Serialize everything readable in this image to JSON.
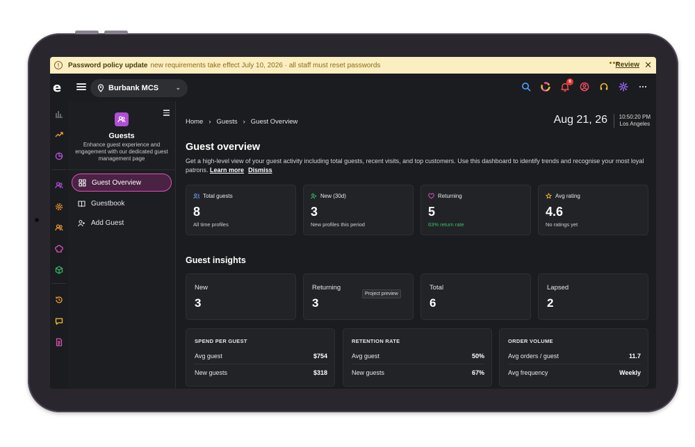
{
  "colors": {
    "accent": "#e052b8",
    "banner_bg": "#fbeec1",
    "positive": "#34c26b",
    "screen_bg": "#1b1c1f"
  },
  "banner": {
    "icon": "warning-icon",
    "title": "Password policy update",
    "message": "new requirements take effect July 10, 2026 · all staff must reset passwords",
    "review_label": "Review",
    "close_label": "✕"
  },
  "topbar": {
    "logo": "e",
    "location": "Burbank MCS",
    "notification_count": "6",
    "icons": [
      "search-icon",
      "app-switcher-icon",
      "bell-icon",
      "user-circle-icon",
      "headset-icon",
      "settings-icon",
      "more-icon"
    ]
  },
  "rail": {
    "icons": [
      "bar-chart-icon",
      "trend-icon",
      "pie-chart-icon",
      "guests-icon",
      "gear-icon",
      "staff-icon",
      "chef-hat-icon",
      "cube-icon",
      "history-icon",
      "chat-icon",
      "document-icon"
    ]
  },
  "sidebar": {
    "title": "Guests",
    "description": "Enhance guest experience and engagement with our dedicated guest management page",
    "items": [
      {
        "label": "Guest Overview",
        "icon": "grid-icon"
      },
      {
        "label": "Guestbook",
        "icon": "book-icon"
      },
      {
        "label": "Add Guest",
        "icon": "user-plus-icon"
      }
    ]
  },
  "breadcrumb": [
    "Home",
    "Guests",
    "Guest Overview"
  ],
  "date": "Aug 21, 26",
  "time": "10:50:20 PM",
  "timezone": "Los Angeles",
  "page": {
    "title": "Guest overview",
    "lead": "Get a high-level view of your guest activity including total guests, recent visits, and top customers. Use this dashboard to identify trends and recognise your most loyal patrons.",
    "learn_more": "Learn more",
    "dismiss": "Dismiss"
  },
  "stats": [
    {
      "label": "Total guests",
      "value": "8",
      "sub": "All time profiles",
      "icon": "users-icon",
      "color": "#6a9bf4"
    },
    {
      "label": "New (30d)",
      "value": "3",
      "sub": "New profiles this period",
      "icon": "user-plus-icon",
      "color": "#34c26b"
    },
    {
      "label": "Returning",
      "value": "5",
      "sub": "63% return rate",
      "icon": "heart-icon",
      "color": "#e052b8"
    },
    {
      "label": "Avg rating",
      "value": "4.6",
      "sub": "No ratings yet",
      "icon": "star-icon",
      "color": "#f2c230"
    }
  ],
  "insights": {
    "title": "Guest insights",
    "tooltip": "Project preview",
    "cards": [
      {
        "label": "New",
        "value": "3"
      },
      {
        "label": "Returning",
        "value": "3"
      },
      {
        "label": "Total",
        "value": "6"
      },
      {
        "label": "Lapsed",
        "value": "2"
      }
    ]
  },
  "metrics": [
    {
      "title": "SPEND PER GUEST",
      "rows": [
        {
          "label": "Avg guest",
          "value": "$754"
        },
        {
          "label": "New guests",
          "value": "$318"
        }
      ]
    },
    {
      "title": "RETENTION RATE",
      "rows": [
        {
          "label": "Avg guest",
          "value": "50%"
        },
        {
          "label": "New guests",
          "value": "67%"
        }
      ]
    },
    {
      "title": "ORDER VOLUME",
      "rows": [
        {
          "label": "Avg orders / guest",
          "value": "11.7"
        },
        {
          "label": "Avg frequency",
          "value": "Weekly"
        }
      ]
    }
  ]
}
